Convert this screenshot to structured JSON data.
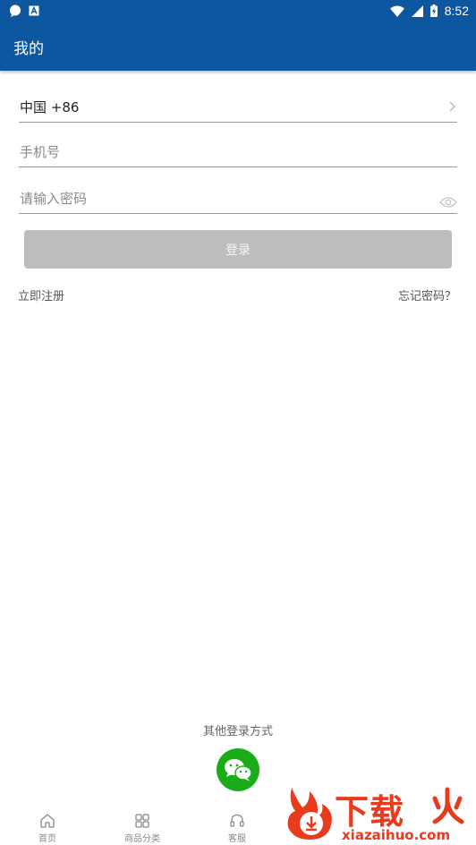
{
  "status_bar": {
    "time": "8:52",
    "left_icons": [
      "chat-bubble-icon",
      "a-box-icon"
    ],
    "right_icons": [
      "wifi-icon",
      "signal-icon",
      "battery-charging-icon"
    ]
  },
  "app_bar": {
    "title": "我的"
  },
  "form": {
    "region_value": "中国 +86",
    "phone_placeholder": "手机号",
    "password_placeholder": "请输入密码",
    "login_label": "登录",
    "register_label": "立即注册",
    "forgot_label": "忘记密码？"
  },
  "other_login": {
    "label": "其他登录方式",
    "icon": "wechat-icon"
  },
  "tab_bar": {
    "items": [
      {
        "label": "首页",
        "icon": "home-icon"
      },
      {
        "label": "商品分类",
        "icon": "grid-icon"
      },
      {
        "label": "客服",
        "icon": "headset-icon"
      }
    ]
  },
  "watermark": {
    "text": "下载",
    "url": "xiazaihuo.com"
  },
  "colors": {
    "primary": "#0d56a0",
    "button_disabled": "#bdbdbd",
    "wechat": "#1aad19",
    "watermark": "#e83b1e"
  }
}
